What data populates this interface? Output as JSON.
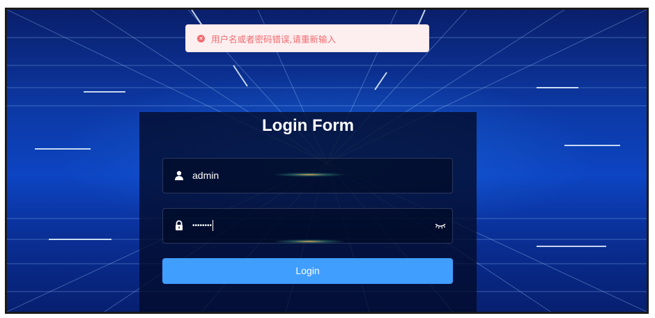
{
  "alert": {
    "icon": "error-circle-icon",
    "message": "用户名或者密码错误,请重新输入",
    "color": "#f16b6f",
    "background": "#fdeff0"
  },
  "login_form": {
    "title": "Login Form",
    "username": {
      "icon": "user-icon",
      "value": "admin"
    },
    "password": {
      "icon": "lock-icon",
      "masked_value": "••••••••",
      "toggle_icon": "eye-closed-icon"
    },
    "submit_label": "Login",
    "button_color": "#409eff"
  },
  "theme": {
    "background": "#0c3aa8"
  }
}
